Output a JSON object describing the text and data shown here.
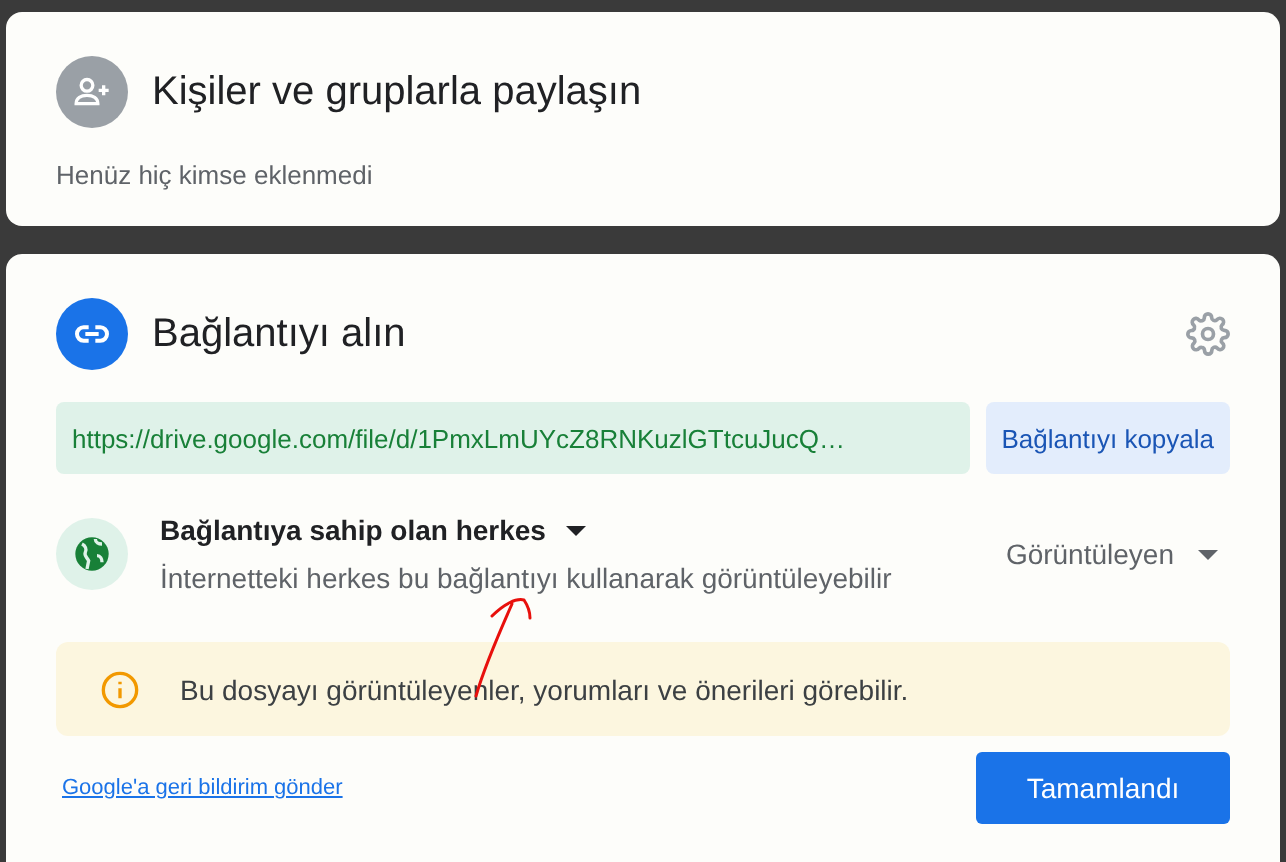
{
  "share_people": {
    "title": "Kişiler ve gruplarla paylaşın",
    "subtitle": "Henüz hiç kimse eklenmedi"
  },
  "get_link": {
    "title": "Bağlantıyı alın",
    "url": "https://drive.google.com/file/d/1PmxLmUYcZ8RNKuzlGTtcuJucQ…",
    "copy_button": "Bağlantıyı kopyala",
    "access": {
      "label": "Bağlantıya sahip olan herkes",
      "description": "İnternetteki herkes bu bağlantıyı kullanarak görüntüleyebilir",
      "role": "Görüntüleyen"
    },
    "notice": "Bu dosyayı görüntüleyenler, yorumları ve önerileri görebilir.",
    "feedback_link": "Google'a geri bildirim gönder",
    "done_button": "Tamamlandı"
  }
}
